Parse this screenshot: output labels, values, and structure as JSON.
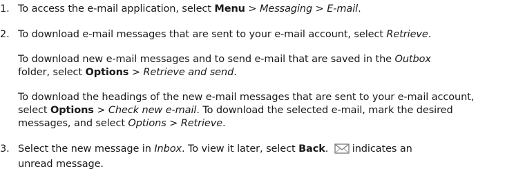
{
  "steps": [
    {
      "number": "1.",
      "t1": "To access the e-mail application, select ",
      "b1": "Menu",
      "t2": " > ",
      "i1": "Messaging",
      "t3": " > ",
      "i2": "E-mail",
      "t4": "."
    },
    {
      "number": "2.",
      "t1": "To download e-mail messages that are sent to your e-mail account, select ",
      "i1": "Retrieve",
      "t2": "."
    },
    {
      "number": "3.",
      "t1": "Select the new message in ",
      "i1": "Inbox",
      "t2": ". To view it later, select ",
      "b1": "Back",
      "t3": ". ",
      "t4": "indicates an",
      "t5": "unread message.",
      "icon": "unread-envelope-icon"
    }
  ],
  "para_a": {
    "line1": "To download new e-mail messages and to send e-mail that are saved in the ",
    "i1": "Outbox",
    "line2a": "folder, select ",
    "b1": "Options",
    "t1": " > ",
    "i2": "Retrieve and send",
    "t2": "."
  },
  "para_b": {
    "line1": "To download the headings of the new e-mail messages that are sent to your e-mail account,",
    "line2a": "select ",
    "b1": "Options",
    "t1": " > ",
    "i1": "Check new e-mail",
    "t2": ". To download the selected e-mail, mark the desired",
    "line3a": "messages, and select ",
    "i2": "Options",
    "t3": " > ",
    "i3": "Retrieve",
    "t4": "."
  }
}
